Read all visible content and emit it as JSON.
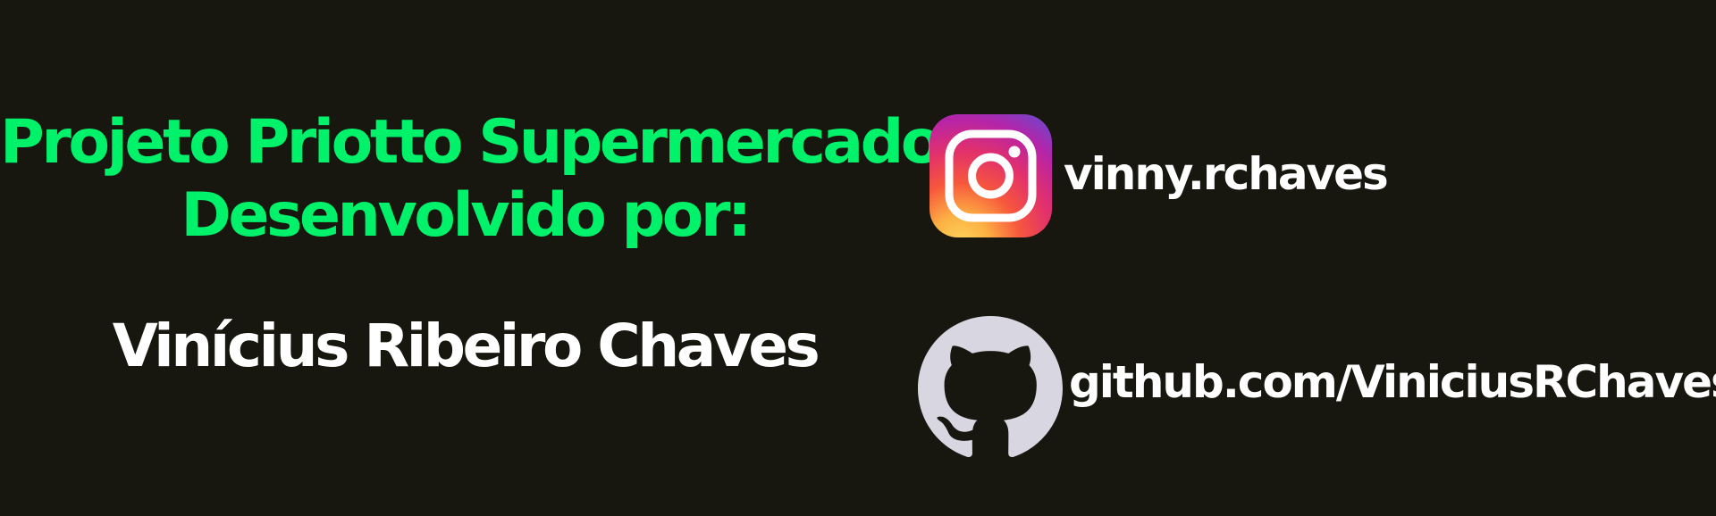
{
  "banner": {
    "project_title": "Projeto Priotto Supermercado",
    "developed_by_label": "Desenvolvido por:",
    "author_name": "Vinícius Ribeiro Chaves"
  },
  "socials": {
    "instagram": {
      "icon": "instagram-icon",
      "handle": "vinny.rchaves"
    },
    "github": {
      "icon": "github-icon",
      "link": "github.com/ViniciusRChaves"
    }
  },
  "colors": {
    "background": "#171710",
    "accent_green": "#00f16a",
    "text_white": "#ffffff",
    "github_icon_fill": "#d8d6e0"
  }
}
